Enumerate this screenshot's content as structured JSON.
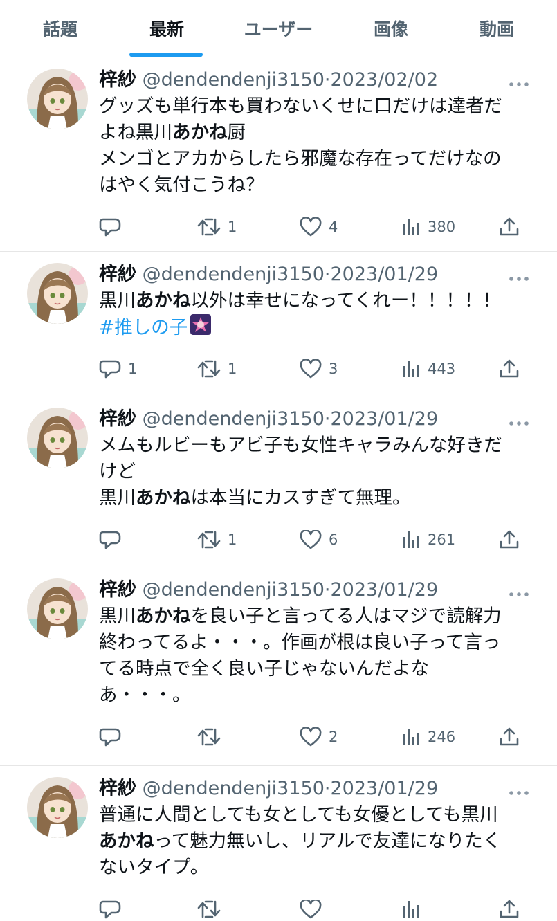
{
  "tabs": [
    {
      "label": "話題",
      "active": false
    },
    {
      "label": "最新",
      "active": true
    },
    {
      "label": "ユーザー",
      "active": false
    },
    {
      "label": "画像",
      "active": false
    },
    {
      "label": "動画",
      "active": false
    }
  ],
  "tweets": [
    {
      "name": "梓紗",
      "handle": "@dendendenji3150",
      "date": "2023/02/02",
      "segments": [
        {
          "text": "グッズも単行本も買わないくせに口だけは達者だ\nよね黒川",
          "style": "normal"
        },
        {
          "text": "あかね",
          "style": "bold"
        },
        {
          "text": "厨\nメンゴとアカからしたら邪魔な存在ってだけなの\nはやく気付こうね？",
          "style": "normal"
        }
      ],
      "replies": "",
      "retweets": "1",
      "likes": "4",
      "views": "380"
    },
    {
      "name": "梓紗",
      "handle": "@dendendenji3150",
      "date": "2023/01/29",
      "segments": [
        {
          "text": "黒川",
          "style": "normal"
        },
        {
          "text": "あかね",
          "style": "bold"
        },
        {
          "text": "以外は幸せになってくれー！！！！！\n",
          "style": "normal"
        },
        {
          "text": "#推しの子",
          "style": "hashtag"
        }
      ],
      "replies": "1",
      "retweets": "1",
      "likes": "3",
      "views": "443"
    },
    {
      "name": "梓紗",
      "handle": "@dendendenji3150",
      "date": "2023/01/29",
      "segments": [
        {
          "text": "メムもルビーもアビ子も女性キャラみんな好きだ\nけど\n黒川",
          "style": "normal"
        },
        {
          "text": "あかね",
          "style": "bold"
        },
        {
          "text": "は本当にカスすぎて無理。",
          "style": "normal"
        }
      ],
      "replies": "",
      "retweets": "1",
      "likes": "6",
      "views": "261"
    },
    {
      "name": "梓紗",
      "handle": "@dendendenji3150",
      "date": "2023/01/29",
      "segments": [
        {
          "text": "黒川",
          "style": "normal"
        },
        {
          "text": "あかね",
          "style": "bold"
        },
        {
          "text": "を良い子と言ってる人はマジで読解力\n終わってるよ・・・。作画が根は良い子って言っ\nてる時点で全く良い子じゃないんだよな\nあ・・・。",
          "style": "normal"
        }
      ],
      "replies": "",
      "retweets": "",
      "likes": "2",
      "views": "246"
    },
    {
      "name": "梓紗",
      "handle": "@dendendenji3150",
      "date": "2023/01/29",
      "segments": [
        {
          "text": "普通に人間としても女としても女優としても黒川\n",
          "style": "normal"
        },
        {
          "text": "あかね",
          "style": "bold"
        },
        {
          "text": "って魅力無いし、リアルで友達になりたく\nないタイプ。",
          "style": "normal"
        }
      ],
      "replies": "",
      "retweets": "",
      "likes": "",
      "views": ""
    }
  ],
  "colors": {
    "accent": "#1d9bf0",
    "text": "#0f1419",
    "muted": "#536471"
  }
}
